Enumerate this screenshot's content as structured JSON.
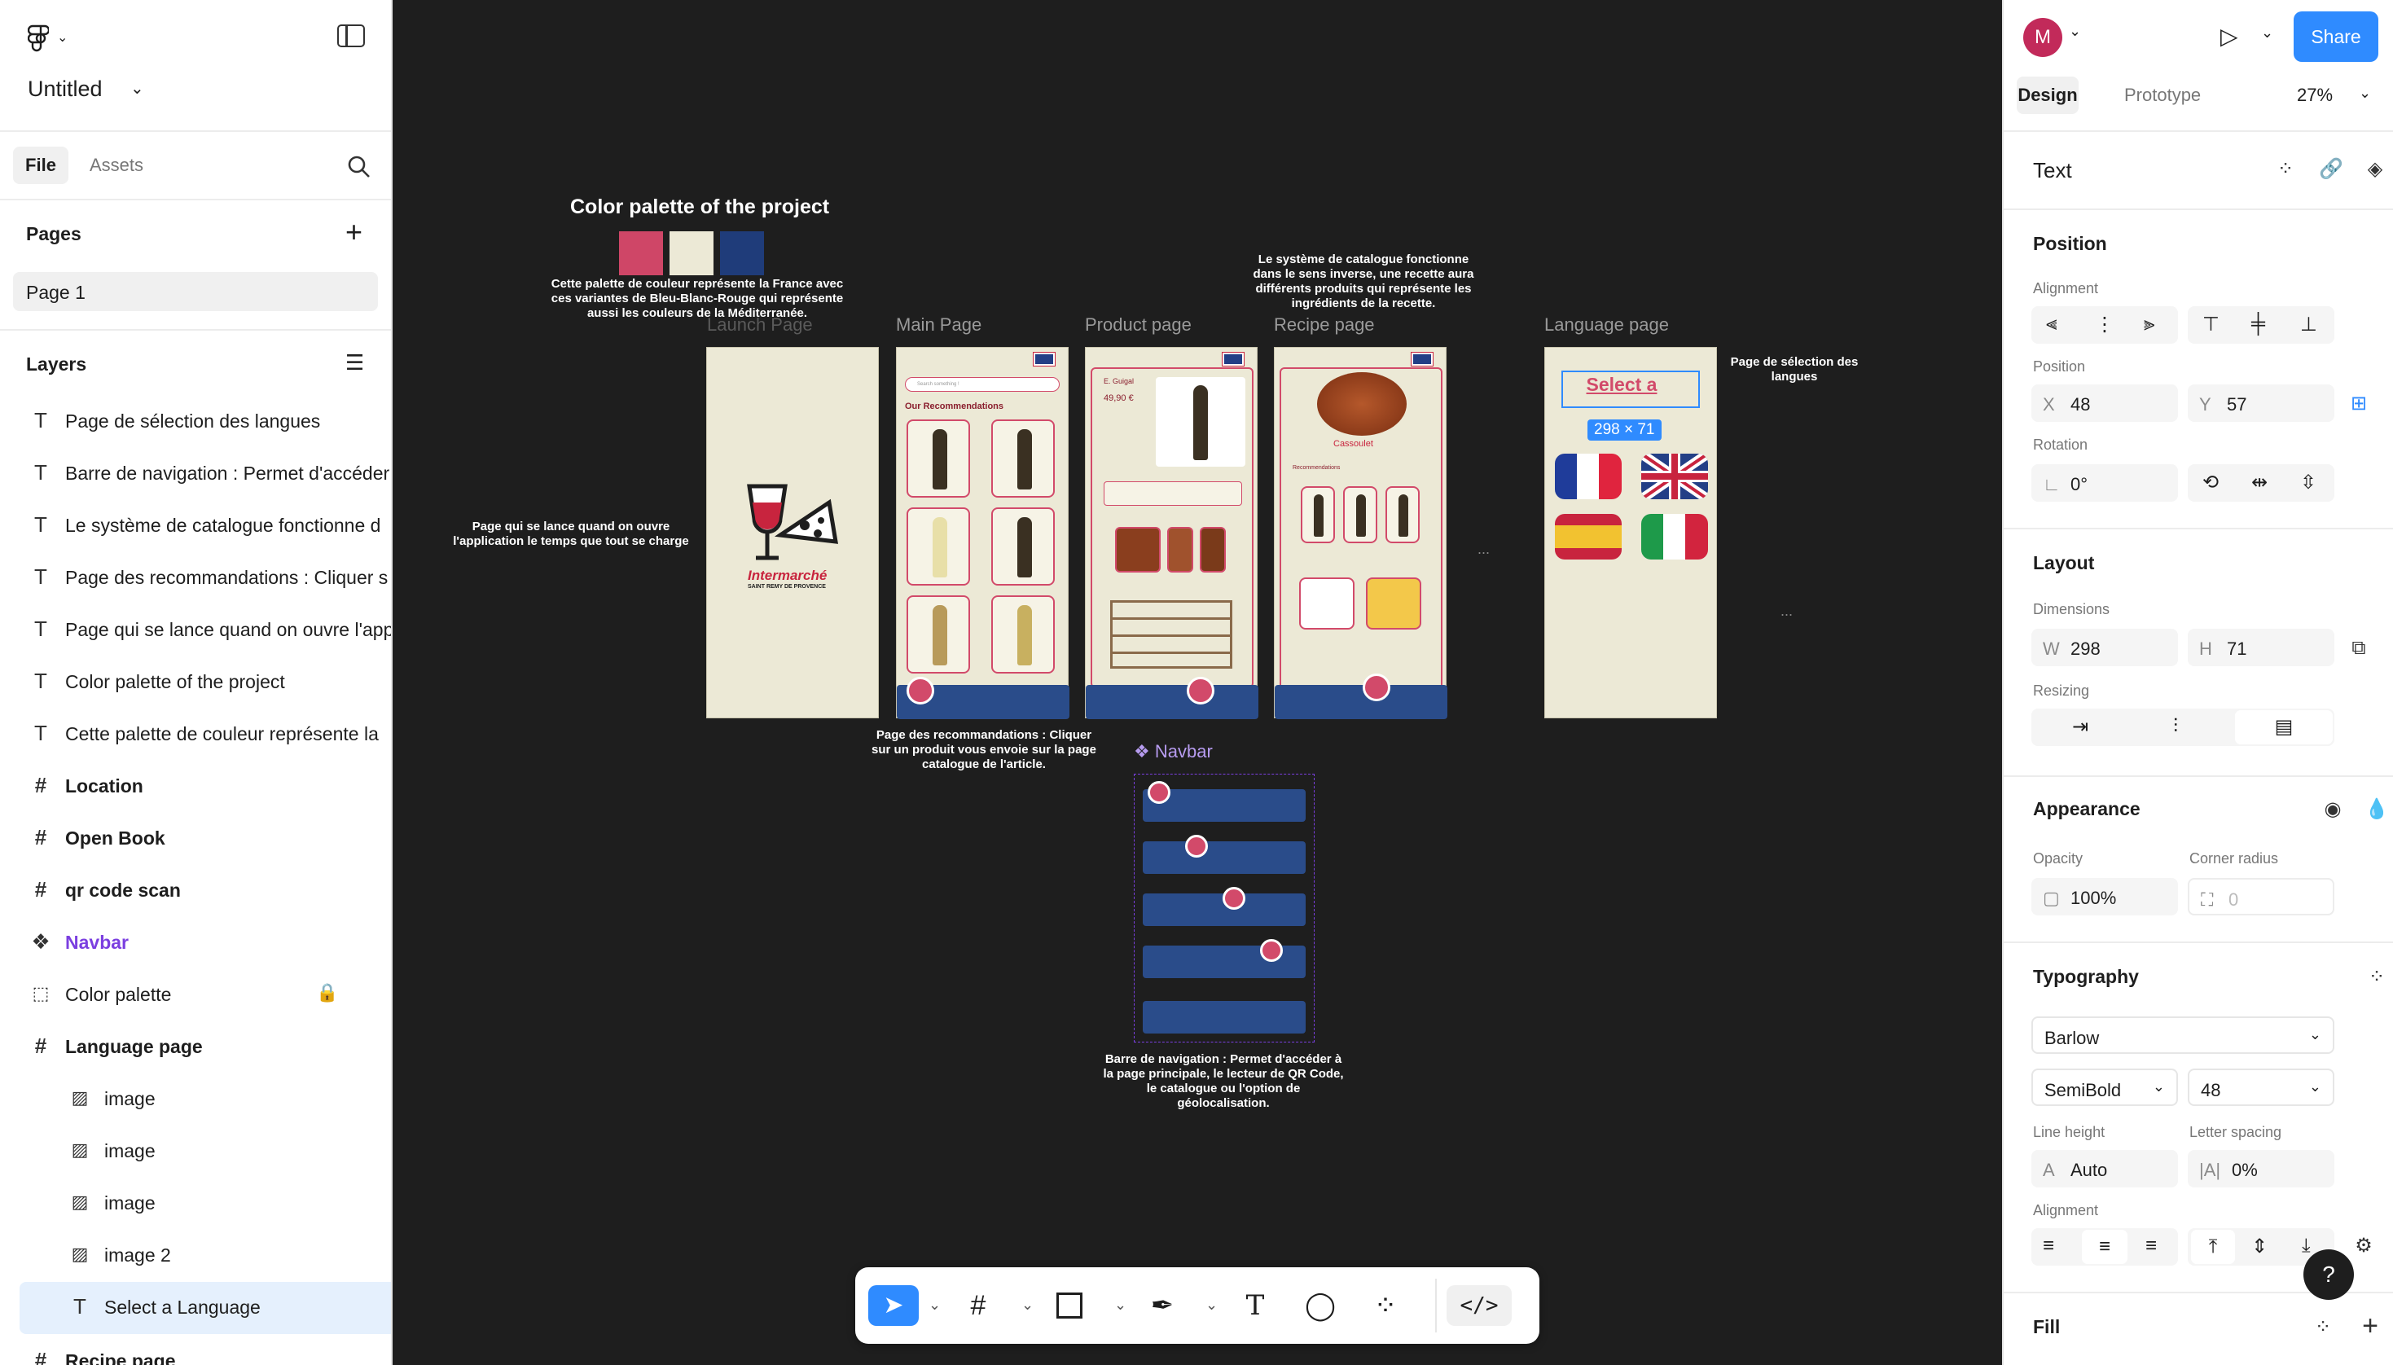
{
  "file": {
    "name": "Untitled"
  },
  "left_tabs": {
    "file": "File",
    "assets": "Assets"
  },
  "pages": {
    "heading": "Pages",
    "items": [
      "Page 1"
    ]
  },
  "layers": {
    "heading": "Layers",
    "items": [
      {
        "type": "text",
        "label": "Page de sélection des langues"
      },
      {
        "type": "text",
        "label": "Barre de navigation : Permet d'accéder"
      },
      {
        "type": "text",
        "label": "Le système de catalogue fonctionne d"
      },
      {
        "type": "text",
        "label": "Page des recommandations : Cliquer s"
      },
      {
        "type": "text",
        "label": "Page qui se lance quand on ouvre l'app"
      },
      {
        "type": "text",
        "label": "Color palette of the project"
      },
      {
        "type": "text",
        "label": "Cette palette de couleur représente la"
      },
      {
        "type": "frame",
        "label": "Location"
      },
      {
        "type": "frame",
        "label": "Open Book"
      },
      {
        "type": "frame",
        "label": "qr code scan"
      },
      {
        "type": "component",
        "label": "Navbar"
      },
      {
        "type": "section",
        "label": "Color palette"
      },
      {
        "type": "frame",
        "label": "Language page"
      },
      {
        "type": "image",
        "label": "image"
      },
      {
        "type": "image",
        "label": "image"
      },
      {
        "type": "image",
        "label": "image"
      },
      {
        "type": "image",
        "label": "image 2"
      },
      {
        "type": "text",
        "label": "Select a Language"
      },
      {
        "type": "frame",
        "label": "Recipe page"
      }
    ]
  },
  "canvas": {
    "palette_title": "Color palette of the project",
    "palette_colors": [
      "#cf4667",
      "#ece9d6",
      "#1f3c7a"
    ],
    "palette_note": "Cette palette de couleur représente la France avec ces variantes de Bleu-Blanc-Rouge qui représente aussi les couleurs de la Méditerranée.",
    "catalogue_note": "Le système de catalogue fonctionne dans le sens inverse, une recette aura différents produits qui représente les ingrédients de la recette.",
    "frames": {
      "launch": "Launch Page",
      "main": "Main Page",
      "product": "Product page",
      "recipe": "Recipe page",
      "language": "Language page"
    },
    "launch_note": "Page qui se lance quand on ouvre l'application le temps que tout se charge",
    "reco_note": "Page des recommandations : Cliquer sur un produit vous envoie sur la page catalogue de l'article.",
    "lang_note": "Page de sélection des langues",
    "navbar_title": "Navbar",
    "navbar_note": "Barre de navigation : Permet d'accéder à la page principale, le lecteur de QR Code, le catalogue ou l'option de géolocalisation.",
    "main_heading": "Our Recommendations",
    "main_search": "Search something !",
    "brand": "Intermarché",
    "brand_sub": "SAINT REMY DE PROVENCE",
    "product_name": "E. Guigal",
    "product_price": "49,90 €",
    "recipe_name": "Cassoulet",
    "recipe_wines": "Recommendations",
    "select_language": "Select a Language",
    "selection_size": "298 × 71"
  },
  "right": {
    "share": "Share",
    "avatar_initial": "M",
    "tabs": {
      "design": "Design",
      "prototype": "Prototype"
    },
    "zoom": "27%",
    "selection_type": "Text",
    "position": {
      "heading": "Position",
      "alignment_label": "Alignment",
      "position_label": "Position",
      "x": "48",
      "y": "57",
      "rotation_label": "Rotation",
      "rotation": "0°"
    },
    "layout": {
      "heading": "Layout",
      "dimensions_label": "Dimensions",
      "w": "298",
      "h": "71",
      "resizing_label": "Resizing"
    },
    "appearance": {
      "heading": "Appearance",
      "opacity_label": "Opacity",
      "opacity": "100%",
      "radius_label": "Corner radius",
      "radius": "0"
    },
    "typography": {
      "heading": "Typography",
      "font": "Barlow",
      "weight": "SemiBold",
      "size": "48",
      "line_height_label": "Line height",
      "line_height": "Auto",
      "letter_spacing_label": "Letter spacing",
      "letter_spacing": "0%",
      "alignment_label": "Alignment"
    },
    "fill_heading": "Fill",
    "help": "?"
  }
}
